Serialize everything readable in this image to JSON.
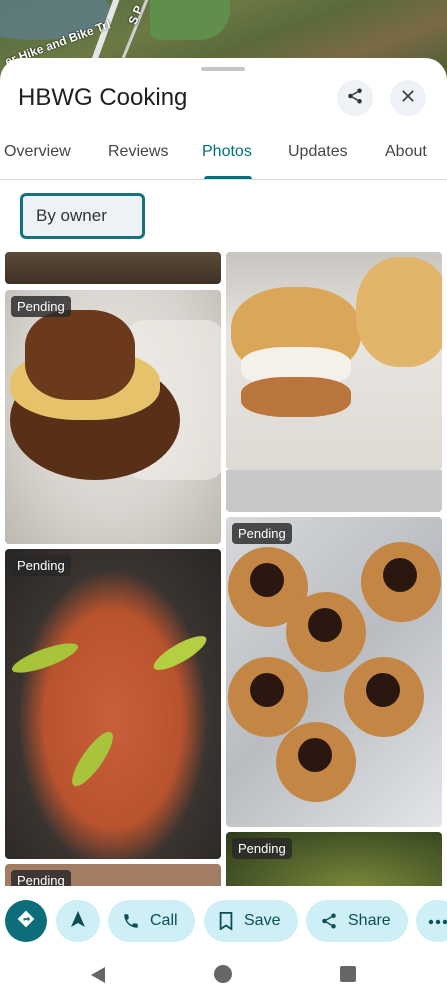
{
  "map": {
    "trail_label": "er Hike and Bike Trl",
    "road_label": "S P"
  },
  "place": {
    "title": "HBWG Cooking"
  },
  "tabs": [
    {
      "label": "Overview"
    },
    {
      "label": "Reviews"
    },
    {
      "label": "Photos"
    },
    {
      "label": "Updates"
    },
    {
      "label": "About"
    }
  ],
  "active_tab": "Photos",
  "filter": {
    "label": "By owner"
  },
  "photos": {
    "pending_label": "Pending"
  },
  "actions": {
    "call": "Call",
    "save": "Save",
    "share": "Share"
  },
  "colors": {
    "accent": "#00707a",
    "chip_bg": "#cdeff5",
    "directions_fab": "#0e6d7a"
  },
  "icons": {
    "share": "share-icon",
    "close": "close-icon",
    "directions": "directions-icon",
    "start": "navigation-arrow-icon",
    "call": "phone-icon",
    "save": "bookmark-icon",
    "more": "more-horiz-icon"
  }
}
